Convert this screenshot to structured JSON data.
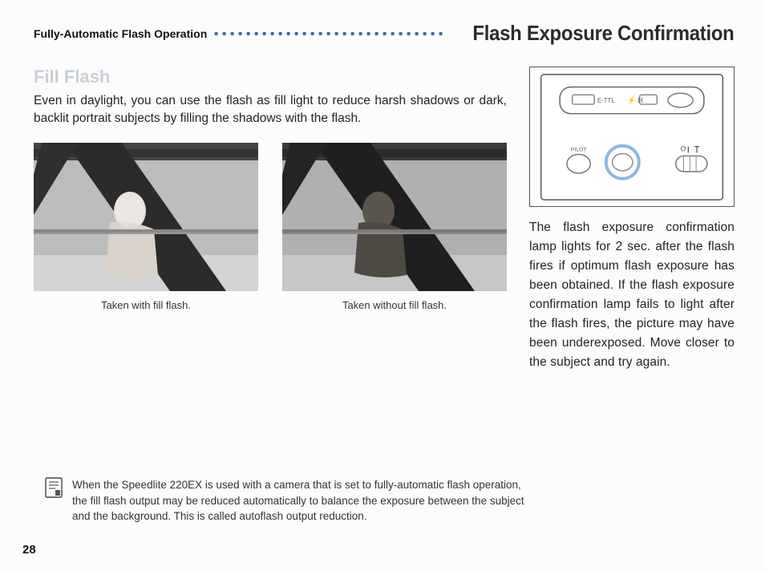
{
  "header": {
    "section_label": "Fully-Automatic Flash Operation",
    "page_title": "Flash Exposure Confirmation"
  },
  "left": {
    "subhead": "Fill Flash",
    "intro": "Even in daylight, you can use the flash as fill light to reduce harsh shadows or dark, backlit portrait subjects by filling the shadows with the flash.",
    "captions": {
      "with_flash": "Taken with fill flash.",
      "without_flash": "Taken without fill flash."
    }
  },
  "right": {
    "diagram_labels": {
      "ettl": "E-TTL",
      "hsync": "H",
      "pilot": "PILOT",
      "switch": "O"
    },
    "body": "The flash exposure confirmation lamp lights for 2 sec. after the flash fires if optimum flash exposure has been obtained. If the flash exposure confirmation lamp fails to light after the flash fires, the picture may have been underexposed. Move closer to the subject and try again."
  },
  "note": {
    "text": "When the Speedlite 220EX is used with a camera that is set to fully-automatic flash operation, the fill flash output may be reduced automatically to balance the exposure between the subject and the background. This is called autoflash output reduction."
  },
  "page_number": "28"
}
